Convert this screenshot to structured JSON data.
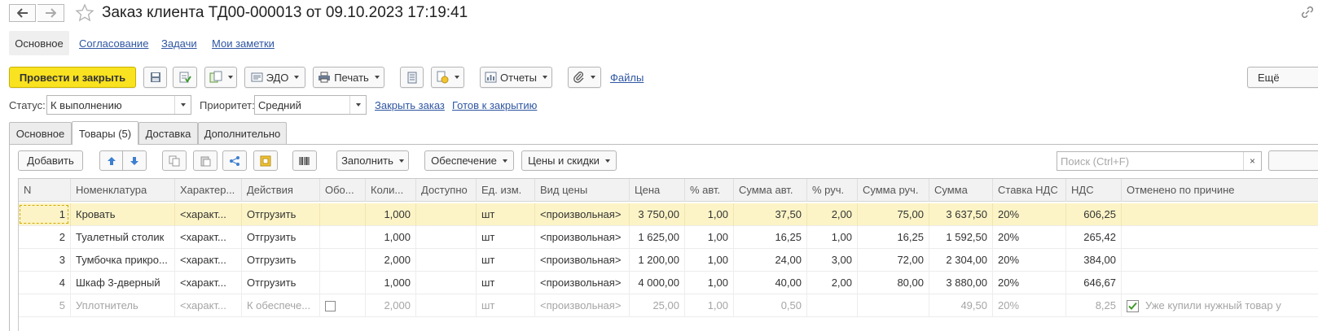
{
  "window": {
    "title": "Заказ клиента ТД00-000013 от 09.10.2023 17:19:41"
  },
  "section_tabs": {
    "active": "Основное",
    "links": [
      "Согласование",
      "Задачи",
      "Мои заметки"
    ]
  },
  "toolbar": {
    "post_close_label": "Провести и закрыть",
    "edo_label": "ЭДО",
    "print_label": "Печать",
    "reports_label": "Отчеты",
    "files_label": "Файлы",
    "more_label": "Ещё"
  },
  "status_row": {
    "status_label": "Статус:",
    "status_value": "К выполнению",
    "priority_label": "Приоритет:",
    "priority_value": "Средний",
    "close_order_link": "Закрыть заказ",
    "ready_to_close_link": "Готов к закрытию"
  },
  "content_tabs": [
    "Основное",
    "Товары (5)",
    "Доставка",
    "Дополнительно"
  ],
  "table_toolbar": {
    "add_label": "Добавить",
    "fill_label": "Заполнить",
    "supply_label": "Обеспечение",
    "prices_label": "Цены и скидки",
    "search_placeholder": "Поиск (Ctrl+F)",
    "search_clear": "×"
  },
  "table": {
    "columns": [
      "N",
      "Номенклатура",
      "Характер...",
      "Действия",
      "Обо...",
      "Коли...",
      "Доступно",
      "Ед. изм.",
      "Вид цены",
      "Цена",
      "% авт.",
      "Сумма авт.",
      "% руч.",
      "Сумма руч.",
      "Сумма",
      "Ставка НДС",
      "НДС",
      "Отменено по причине"
    ],
    "rows": [
      {
        "n": "1",
        "name": "Кровать",
        "char": "<характ...",
        "action": "Отгрузить",
        "qty": "1,000",
        "unit": "шт",
        "price_type": "<произвольная>",
        "price": "3 750,00",
        "pct_auto": "1,00",
        "sum_auto": "37,50",
        "pct_manual": "2,00",
        "sum_manual": "75,00",
        "sum": "3 637,50",
        "vat_rate": "20%",
        "vat": "606,25",
        "cancel_reason": ""
      },
      {
        "n": "2",
        "name": "Туалетный столик",
        "char": "<характ...",
        "action": "Отгрузить",
        "qty": "1,000",
        "unit": "шт",
        "price_type": "<произвольная>",
        "price": "1 625,00",
        "pct_auto": "1,00",
        "sum_auto": "16,25",
        "pct_manual": "1,00",
        "sum_manual": "16,25",
        "sum": "1 592,50",
        "vat_rate": "20%",
        "vat": "265,42",
        "cancel_reason": ""
      },
      {
        "n": "3",
        "name": "Тумбочка прикро...",
        "char": "<характ...",
        "action": "Отгрузить",
        "qty": "2,000",
        "unit": "шт",
        "price_type": "<произвольная>",
        "price": "1 200,00",
        "pct_auto": "1,00",
        "sum_auto": "24,00",
        "pct_manual": "3,00",
        "sum_manual": "72,00",
        "sum": "2 304,00",
        "vat_rate": "20%",
        "vat": "384,00",
        "cancel_reason": ""
      },
      {
        "n": "4",
        "name": "Шкаф 3-дверный",
        "char": "<характ...",
        "action": "Отгрузить",
        "qty": "1,000",
        "unit": "шт",
        "price_type": "<произвольная>",
        "price": "4 000,00",
        "pct_auto": "1,00",
        "sum_auto": "40,00",
        "pct_manual": "2,00",
        "sum_manual": "80,00",
        "sum": "3 880,00",
        "vat_rate": "20%",
        "vat": "646,67",
        "cancel_reason": ""
      },
      {
        "n": "5",
        "name": "Уплотнитель",
        "char": "<характ...",
        "action": "К обеспече...",
        "qty": "2,000",
        "unit": "шт",
        "price_type": "<произвольная>",
        "price": "25,00",
        "pct_auto": "1,00",
        "sum_auto": "0,50",
        "pct_manual": "",
        "sum_manual": "",
        "sum": "49,50",
        "vat_rate": "20%",
        "vat": "8,25",
        "cancel_reason": "Уже купили нужный товар у"
      }
    ]
  },
  "colors": {
    "primary_button": "#f9e21f",
    "selected_row": "#fcf4c6",
    "link": "#2f56a2"
  }
}
